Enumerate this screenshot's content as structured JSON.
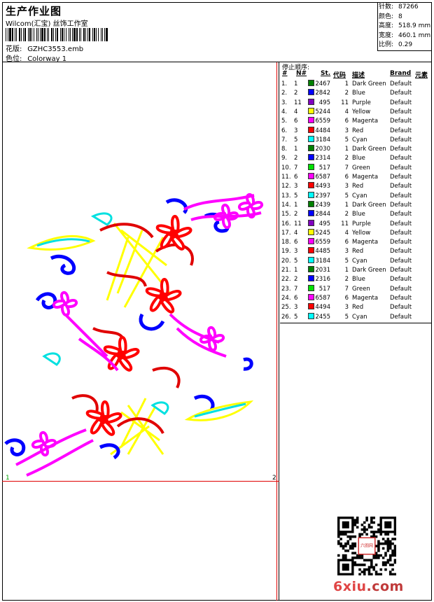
{
  "header": {
    "title": "生产作业图",
    "company": "Wilcom(汇宝) 丝饰工作室",
    "design_label": "花版:",
    "design_value": "GZHC3553.emb",
    "colorway_label": "色位:",
    "colorway_value": "Colorway 1"
  },
  "stats": [
    {
      "label": "针数:",
      "value": "87266"
    },
    {
      "label": "颜色:",
      "value": "8"
    },
    {
      "label": "高度:",
      "value": "518.9 mm"
    },
    {
      "label": "宽度:",
      "value": "460.1 mm"
    },
    {
      "label": "比例:",
      "value": "0.29"
    }
  ],
  "design_area": {
    "corner_left": "1",
    "corner_right": "2"
  },
  "stop_sequence": {
    "title": "停止顺序:",
    "headers": [
      "#",
      "N#",
      "St.",
      "代码",
      "描述",
      "Brand",
      "元素"
    ],
    "rows": [
      {
        "idx": "1.",
        "n": "1",
        "color": "#008000",
        "st": "2467",
        "code": "1",
        "desc": "Dark Green",
        "brand": "Default"
      },
      {
        "idx": "2.",
        "n": "2",
        "color": "#0000ff",
        "st": "2842",
        "code": "2",
        "desc": "Blue",
        "brand": "Default"
      },
      {
        "idx": "3.",
        "n": "11",
        "color": "#8000c0",
        "st": "495",
        "code": "11",
        "desc": "Purple",
        "brand": "Default"
      },
      {
        "idx": "4.",
        "n": "4",
        "color": "#ffff00",
        "st": "5244",
        "code": "4",
        "desc": "Yellow",
        "brand": "Default"
      },
      {
        "idx": "5.",
        "n": "6",
        "color": "#ff00ff",
        "st": "6559",
        "code": "6",
        "desc": "Magenta",
        "brand": "Default"
      },
      {
        "idx": "6.",
        "n": "3",
        "color": "#ff0000",
        "st": "4484",
        "code": "3",
        "desc": "Red",
        "brand": "Default"
      },
      {
        "idx": "7.",
        "n": "5",
        "color": "#00ffff",
        "st": "3184",
        "code": "5",
        "desc": "Cyan",
        "brand": "Default"
      },
      {
        "idx": "8.",
        "n": "1",
        "color": "#008000",
        "st": "2030",
        "code": "1",
        "desc": "Dark Green",
        "brand": "Default"
      },
      {
        "idx": "9.",
        "n": "2",
        "color": "#0000ff",
        "st": "2314",
        "code": "2",
        "desc": "Blue",
        "brand": "Default"
      },
      {
        "idx": "10.",
        "n": "7",
        "color": "#00e000",
        "st": "517",
        "code": "7",
        "desc": "Green",
        "brand": "Default"
      },
      {
        "idx": "11.",
        "n": "6",
        "color": "#ff00ff",
        "st": "6587",
        "code": "6",
        "desc": "Magenta",
        "brand": "Default"
      },
      {
        "idx": "12.",
        "n": "3",
        "color": "#ff0000",
        "st": "4493",
        "code": "3",
        "desc": "Red",
        "brand": "Default"
      },
      {
        "idx": "13.",
        "n": "5",
        "color": "#00ffff",
        "st": "2397",
        "code": "5",
        "desc": "Cyan",
        "brand": "Default"
      },
      {
        "idx": "14.",
        "n": "1",
        "color": "#008000",
        "st": "2439",
        "code": "1",
        "desc": "Dark Green",
        "brand": "Default"
      },
      {
        "idx": "15.",
        "n": "2",
        "color": "#0000ff",
        "st": "2844",
        "code": "2",
        "desc": "Blue",
        "brand": "Default"
      },
      {
        "idx": "16.",
        "n": "11",
        "color": "#8000c0",
        "st": "495",
        "code": "11",
        "desc": "Purple",
        "brand": "Default"
      },
      {
        "idx": "17.",
        "n": "4",
        "color": "#ffff00",
        "st": "5245",
        "code": "4",
        "desc": "Yellow",
        "brand": "Default"
      },
      {
        "idx": "18.",
        "n": "6",
        "color": "#ff00ff",
        "st": "6559",
        "code": "6",
        "desc": "Magenta",
        "brand": "Default"
      },
      {
        "idx": "19.",
        "n": "3",
        "color": "#ff0000",
        "st": "4485",
        "code": "3",
        "desc": "Red",
        "brand": "Default"
      },
      {
        "idx": "20.",
        "n": "5",
        "color": "#00ffff",
        "st": "3184",
        "code": "5",
        "desc": "Cyan",
        "brand": "Default"
      },
      {
        "idx": "21.",
        "n": "1",
        "color": "#008000",
        "st": "2031",
        "code": "1",
        "desc": "Dark Green",
        "brand": "Default"
      },
      {
        "idx": "22.",
        "n": "2",
        "color": "#0000ff",
        "st": "2316",
        "code": "2",
        "desc": "Blue",
        "brand": "Default"
      },
      {
        "idx": "23.",
        "n": "7",
        "color": "#00e000",
        "st": "517",
        "code": "7",
        "desc": "Green",
        "brand": "Default"
      },
      {
        "idx": "24.",
        "n": "6",
        "color": "#ff00ff",
        "st": "6587",
        "code": "6",
        "desc": "Magenta",
        "brand": "Default"
      },
      {
        "idx": "25.",
        "n": "3",
        "color": "#ff0000",
        "st": "4494",
        "code": "3",
        "desc": "Red",
        "brand": "Default"
      },
      {
        "idx": "26.",
        "n": "5",
        "color": "#00ffff",
        "st": "2455",
        "code": "5",
        "desc": "Cyan",
        "brand": "Default"
      }
    ]
  },
  "qr": {
    "seal_text": "六图网"
  },
  "watermark": {
    "main": "6xiu",
    "suffix": ".com"
  }
}
